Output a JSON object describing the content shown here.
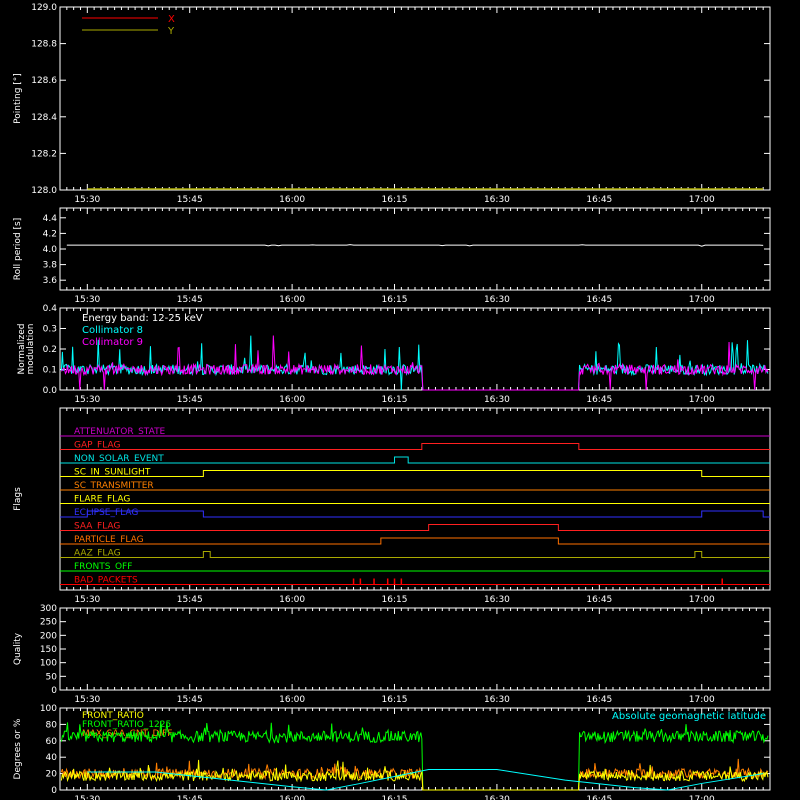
{
  "chart_data": [
    {
      "type": "line",
      "ylabel": "Pointing [°]",
      "ylim": [
        128.0,
        129.0
      ],
      "yticks": [
        "128.0",
        "128.2",
        "128.4",
        "128.6",
        "128.8",
        "129.0"
      ],
      "xticks": [
        "15:30",
        "15:45",
        "16:00",
        "16:15",
        "16:30",
        "16:45",
        "17:00"
      ],
      "legend": [
        {
          "label": "X",
          "color": "#ff0000"
        },
        {
          "label": "Y",
          "color": "#aaaa00"
        }
      ],
      "series": [
        {
          "name": "Y",
          "color": "#aaaa00",
          "x": [
            "15:30",
            "17:09"
          ],
          "values": [
            128.0,
            128.0
          ]
        }
      ]
    },
    {
      "type": "line",
      "ylabel": "Roll period [s]",
      "ylim": [
        3.5,
        4.5
      ],
      "yticks": [
        "3.6",
        "3.8",
        "4.0",
        "4.2",
        "4.4"
      ],
      "xticks": [
        "15:30",
        "15:45",
        "16:00",
        "16:15",
        "16:30",
        "16:45",
        "17:00"
      ],
      "series": [
        {
          "color": "#ffffff",
          "x": [
            "15:30",
            "17:09"
          ],
          "values": [
            4.05,
            4.05
          ]
        }
      ]
    },
    {
      "type": "line",
      "ylabel": "Normalized modulation",
      "ylim": [
        0.0,
        0.4
      ],
      "yticks": [
        "0.0",
        "0.1",
        "0.2",
        "0.3",
        "0.4"
      ],
      "xticks": [
        "15:30",
        "15:45",
        "16:00",
        "16:15",
        "16:30",
        "16:45",
        "17:00"
      ],
      "annotation": "Energy band: 12-25 keV",
      "legend": [
        {
          "label": "Collimator 8",
          "color": "#00ffff"
        },
        {
          "label": "Collimator 9",
          "color": "#ff00ff"
        }
      ],
      "gap": [
        "16:19",
        "16:42"
      ],
      "series": [
        {
          "name": "Collimator 8",
          "color": "#00ffff",
          "baseline": 0.1
        },
        {
          "name": "Collimator 9",
          "color": "#ff00ff",
          "baseline": 0.1
        }
      ]
    },
    {
      "type": "line",
      "ylabel": "Flags",
      "xticks": [
        "15:30",
        "15:45",
        "16:00",
        "16:15",
        "16:30",
        "16:45",
        "17:00"
      ],
      "flags": [
        {
          "label": "ATTENUATOR_STATE",
          "color": "#cc00cc",
          "high": []
        },
        {
          "label": "GAP_FLAG",
          "color": "#ff2020",
          "high": [
            [
              "16:19",
              "16:42"
            ]
          ]
        },
        {
          "label": "NON_SOLAR_EVENT",
          "color": "#00e5e5",
          "high": [
            [
              "16:15",
              "16:17"
            ]
          ]
        },
        {
          "label": "SC_IN_SUNLIGHT",
          "color": "#ffff00",
          "high": [
            [
              "15:47",
              "17:00"
            ]
          ]
        },
        {
          "label": "SC_TRANSMITTER",
          "color": "#ff8000",
          "high": []
        },
        {
          "label": "FLARE_FLAG",
          "color": "#ffff00",
          "high": []
        },
        {
          "label": "ECLIPSE_FLAG",
          "color": "#3030ff",
          "high": [
            [
              "15:30",
              "15:47"
            ],
            [
              "17:00",
              "17:09"
            ]
          ]
        },
        {
          "label": "SAA_FLAG",
          "color": "#ff2020",
          "high": [
            [
              "16:20",
              "16:39"
            ]
          ]
        },
        {
          "label": "PARTICLE_FLAG",
          "color": "#ff7000",
          "high": [
            [
              "16:13",
              "16:39"
            ]
          ]
        },
        {
          "label": "AAZ_FLAG",
          "color": "#aaaa00",
          "high": [
            [
              "15:47",
              "15:48"
            ],
            [
              "16:59",
              "17:00"
            ]
          ]
        },
        {
          "label": "FRONTS_OFF",
          "color": "#00ff00",
          "high": []
        },
        {
          "label": "BAD_PACKETS",
          "color": "#ff0000",
          "spikes": [
            "16:09",
            "16:10",
            "16:12",
            "16:14",
            "16:15",
            "16:16",
            "17:03"
          ]
        }
      ]
    },
    {
      "type": "line",
      "ylabel": "Quality",
      "ylim": [
        0,
        300
      ],
      "yticks": [
        "0",
        "50",
        "100",
        "150",
        "200",
        "250",
        "300"
      ],
      "xticks": [
        "15:30",
        "15:45",
        "16:00",
        "16:15",
        "16:30",
        "16:45",
        "17:00"
      ],
      "series": []
    },
    {
      "type": "line",
      "ylabel": "Degrees or %",
      "ylim": [
        0,
        100
      ],
      "yticks": [
        "0",
        "20",
        "40",
        "60",
        "80",
        "100"
      ],
      "xticks": [
        "15:30",
        "15:45",
        "16:00",
        "16:15",
        "16:30",
        "16:45",
        "17:00"
      ],
      "legend": [
        {
          "label": "FRONT_RATIO",
          "color": "#ffff00"
        },
        {
          "label": "FRONT_RATIO_1225",
          "color": "#00ff00"
        },
        {
          "label": "MAX_SAA_CNT_DIFF",
          "color": "#ff8000"
        }
      ],
      "annotation": "Absolute geomagnetic latitude",
      "annotation_color": "#00ffff",
      "series": [
        {
          "name": "FRONT_RATIO_1225",
          "color": "#00ff00",
          "baseline": 65,
          "gap": [
            "16:19",
            "16:42"
          ]
        },
        {
          "name": "MAX_SAA_CNT_DIFF",
          "color": "#ff8000",
          "baseline": 20,
          "gap": [
            "16:19",
            "16:42"
          ]
        },
        {
          "name": "FRONT_RATIO",
          "color": "#ffff00",
          "baseline": 17,
          "gap": [
            "16:19",
            "16:42"
          ]
        },
        {
          "name": "Absolute geomagnetic latitude",
          "color": "#00ffff",
          "x": [
            "15:30",
            "15:40",
            "15:50",
            "16:00",
            "16:05",
            "16:10",
            "16:20",
            "16:30",
            "16:40",
            "16:50",
            "16:55",
            "17:00",
            "17:09"
          ],
          "values": [
            22,
            22,
            13,
            4,
            0,
            8,
            25,
            25,
            12,
            3,
            0,
            8,
            20
          ]
        }
      ]
    }
  ]
}
